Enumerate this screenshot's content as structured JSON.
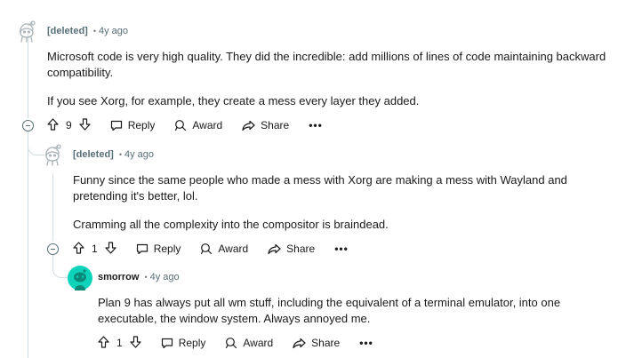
{
  "comments": [
    {
      "author": "[deleted]",
      "time": "4y ago",
      "body": [
        "Microsoft code is very high quality. They did the incredible: add millions of lines of code maintaining backward compatibility.",
        "If you see Xorg, for example, they create a mess every layer they added."
      ],
      "votes": "9",
      "reply_label": "Reply",
      "award_label": "Award",
      "share_label": "Share",
      "more_label": "•••"
    },
    {
      "author": "[deleted]",
      "time": "4y ago",
      "body": [
        "Funny since the same people who made a mess with Xorg are making a mess with Wayland and pretending it's better, lol.",
        "Cramming all the complexity into the compositor is braindead."
      ],
      "votes": "1",
      "reply_label": "Reply",
      "award_label": "Award",
      "share_label": "Share",
      "more_label": "•••"
    },
    {
      "author": "smorrow",
      "time": "4y ago",
      "body": [
        "Plan 9 has always put all wm stuff, including the equivalent of a terminal emulator, into one executable, the window system. Always annoyed me."
      ],
      "votes": "1",
      "reply_label": "Reply",
      "award_label": "Award",
      "share_label": "Share",
      "more_label": "•••"
    }
  ],
  "colors": {
    "thread_line": "#d3dce0",
    "meta_gray": "#576f76",
    "avatar_teal": "#0dd3bb",
    "text": "#1a1a1b"
  },
  "icons": [
    "deleted-avatar-icon",
    "snoo-avatar-icon",
    "upvote-icon",
    "downvote-icon",
    "reply-icon",
    "award-icon",
    "share-icon",
    "collapse-icon"
  ]
}
